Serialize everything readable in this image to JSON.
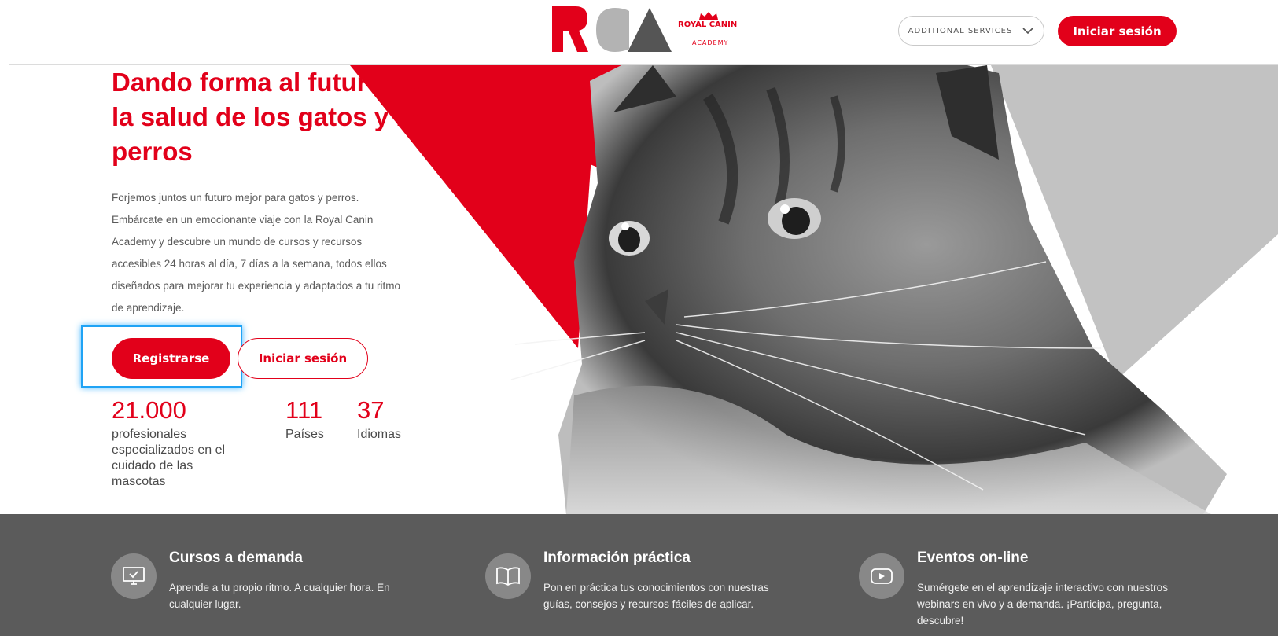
{
  "header": {
    "brand_initials": "RCA",
    "brand_name": "ROYAL CANIN",
    "brand_sub": "ACADEMY",
    "services_label": "ADDITIONAL SERVICES",
    "login_label": "Iniciar sesión"
  },
  "hero": {
    "title": "Dando forma al futuro de la salud de los gatos y los perros",
    "description": "Forjemos juntos un futuro mejor para gatos y perros. Embárcate en un emocionante viaje con la Royal Canin Academy y descubre un mundo de cursos y recursos accesibles 24 horas al día, 7 días a la semana, todos ellos diseñados para mejorar tu experiencia y adaptados a tu ritmo de aprendizaje.",
    "register_label": "Registrarse",
    "login_label": "Iniciar sesión",
    "stats": [
      {
        "number": "21.000",
        "label": "profesionales especializados en el cuidado de las mascotas"
      },
      {
        "number": "111",
        "label": "Países"
      },
      {
        "number": "37",
        "label": "Idiomas"
      }
    ]
  },
  "features": [
    {
      "icon": "monitor-check-icon",
      "title": "Cursos a demanda",
      "text": "Aprende a tu propio ritmo. A cualquier hora. En cualquier lugar."
    },
    {
      "icon": "open-book-icon",
      "title": "Información práctica",
      "text": "Pon en práctica tus conocimientos con nuestras guías, consejos y recursos fáciles de aplicar."
    },
    {
      "icon": "play-video-icon",
      "title": "Eventos on-line",
      "text": "Sumérgete en el aprendizaje interactivo con nuestros webinars en vivo y a demanda. ¡Participa, pregunta, descubre!"
    }
  ],
  "colors": {
    "brand_red": "#e2001a",
    "band_gray": "#5b5b5b",
    "focus_blue": "#1fa3f5"
  }
}
